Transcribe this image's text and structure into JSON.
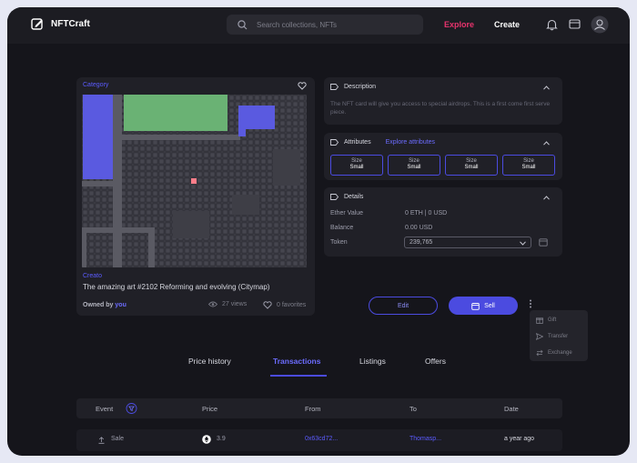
{
  "header": {
    "app_name": "NFTCraft",
    "search_placeholder": "Search collections, NFTs",
    "nav": {
      "explore": "Explore",
      "create": "Create"
    }
  },
  "nft": {
    "category": "Category",
    "creator": "Creato",
    "title": "The amazing art #2102  Reforming and evolving (Citymap)",
    "owned_by_label": "Owned by",
    "owner": "you",
    "views": "27 views",
    "favorites": "0 favorites"
  },
  "description": {
    "title": "Description",
    "text": "The NFT card will give you access to special airdrops. This is a first come first serve piece."
  },
  "attributes": {
    "title": "Attributes",
    "explore_link": "Explore attributes",
    "items": [
      {
        "key": "Size",
        "value": "Small"
      },
      {
        "key": "Size",
        "value": "Small"
      },
      {
        "key": "Size",
        "value": "Small"
      },
      {
        "key": "Size",
        "value": "Small"
      }
    ]
  },
  "details": {
    "title": "Details",
    "ether_label": "Ether Value",
    "ether_value": "0 ETH | 0 USD",
    "balance_label": "Balance",
    "balance_value": "0.00 USD",
    "token_label": "Token",
    "token_value": "239,765"
  },
  "actions": {
    "edit": "Edit",
    "sell": "Sell",
    "menu": [
      "Gift",
      "Transfer",
      "Exchange"
    ]
  },
  "tabs": [
    "Price history",
    "Transactions",
    "Listings",
    "Offers"
  ],
  "table": {
    "headers": [
      "Event",
      "Price",
      "From",
      "To",
      "Date"
    ],
    "rows": [
      {
        "event": "Sale",
        "price": "3.9",
        "from": "0x63cd72...",
        "to": "Thomasp...",
        "date": "a year ago"
      }
    ]
  },
  "colors": {
    "accent": "#4b4be0",
    "explore": "#e8336d",
    "bg": "#15151b",
    "card": "#202027"
  }
}
